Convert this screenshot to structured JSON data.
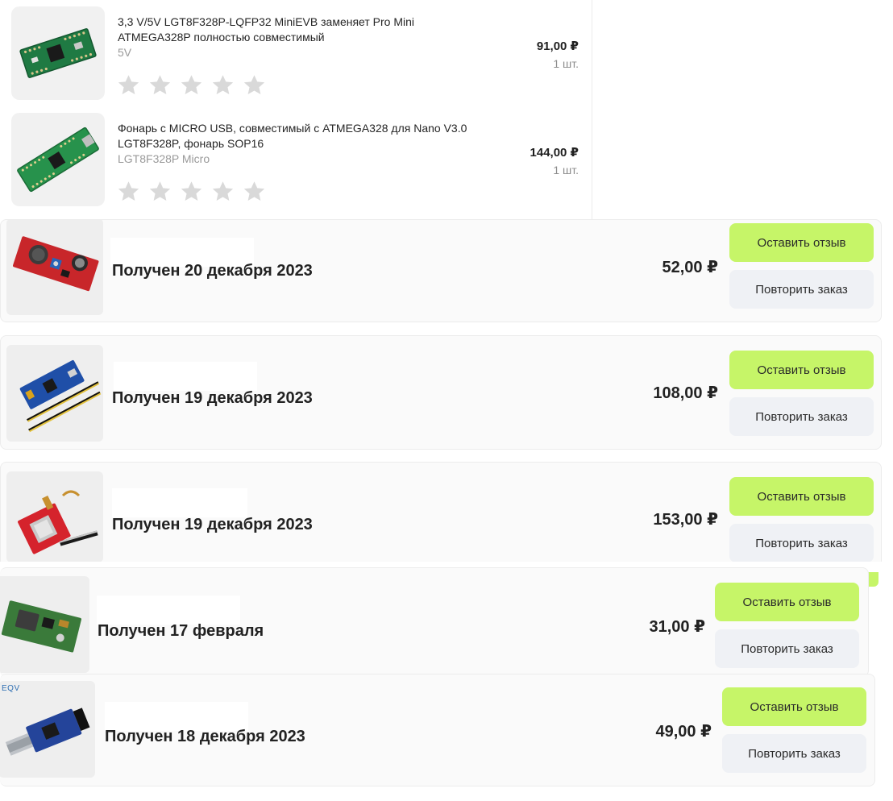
{
  "colors": {
    "accent_button": "#c6f568",
    "secondary_button": "#eff1f5",
    "card_background": "#fafafa",
    "star_inactive": "#d9d9d9"
  },
  "detail_items": [
    {
      "title": "3,3 V/5V LGT8F328P-LQFP32 MiniEVB заменяет Pro Mini ATMEGA328P полностью совместимый",
      "variant": "5V",
      "price": "91,00 ₽",
      "qty": "1 шт.",
      "rating": 0,
      "image": "green-arduino-pro-mini-board"
    },
    {
      "title": "Фонарь с MICRO USB, совместимый с ATMEGA328 для Nano V3.0 LGT8F328P, фонарь SOP16",
      "variant": "LGT8F328P Micro",
      "price": "144,00 ₽",
      "qty": "1 шт.",
      "rating": 0,
      "image": "green-nano-board"
    }
  ],
  "orders": [
    {
      "status": "Получен 20 декабря 2023",
      "amount": "52,00 ₽",
      "review_label": "Оставить отзыв",
      "repeat_label": "Повторить заказ",
      "image": "red-dc-dc-buck-converter"
    },
    {
      "status": "Получен 19 декабря 2023",
      "amount": "108,00 ₽",
      "review_label": "Оставить отзыв",
      "repeat_label": "Повторить заказ",
      "image": "blue-stm32-board-with-pin-headers"
    },
    {
      "status": "Получен 19 декабря 2023",
      "amount": "153,00 ₽",
      "review_label": "Оставить отзыв",
      "repeat_label": "Повторить заказ",
      "image": "red-gsm-module-with-antenna"
    },
    {
      "status": "Получен 17 февраля",
      "amount": "31,00 ₽",
      "review_label": "Оставить отзыв",
      "repeat_label": "Повторить заказ",
      "image": "green-dc-dc-power-module"
    },
    {
      "status": "Получен 18 декабря 2023",
      "amount": "49,00 ₽",
      "review_label": "Оставить отзыв",
      "repeat_label": "Повторить заказ",
      "image": "blue-usb-ttl-adapter",
      "image_brand": "EQV"
    }
  ]
}
